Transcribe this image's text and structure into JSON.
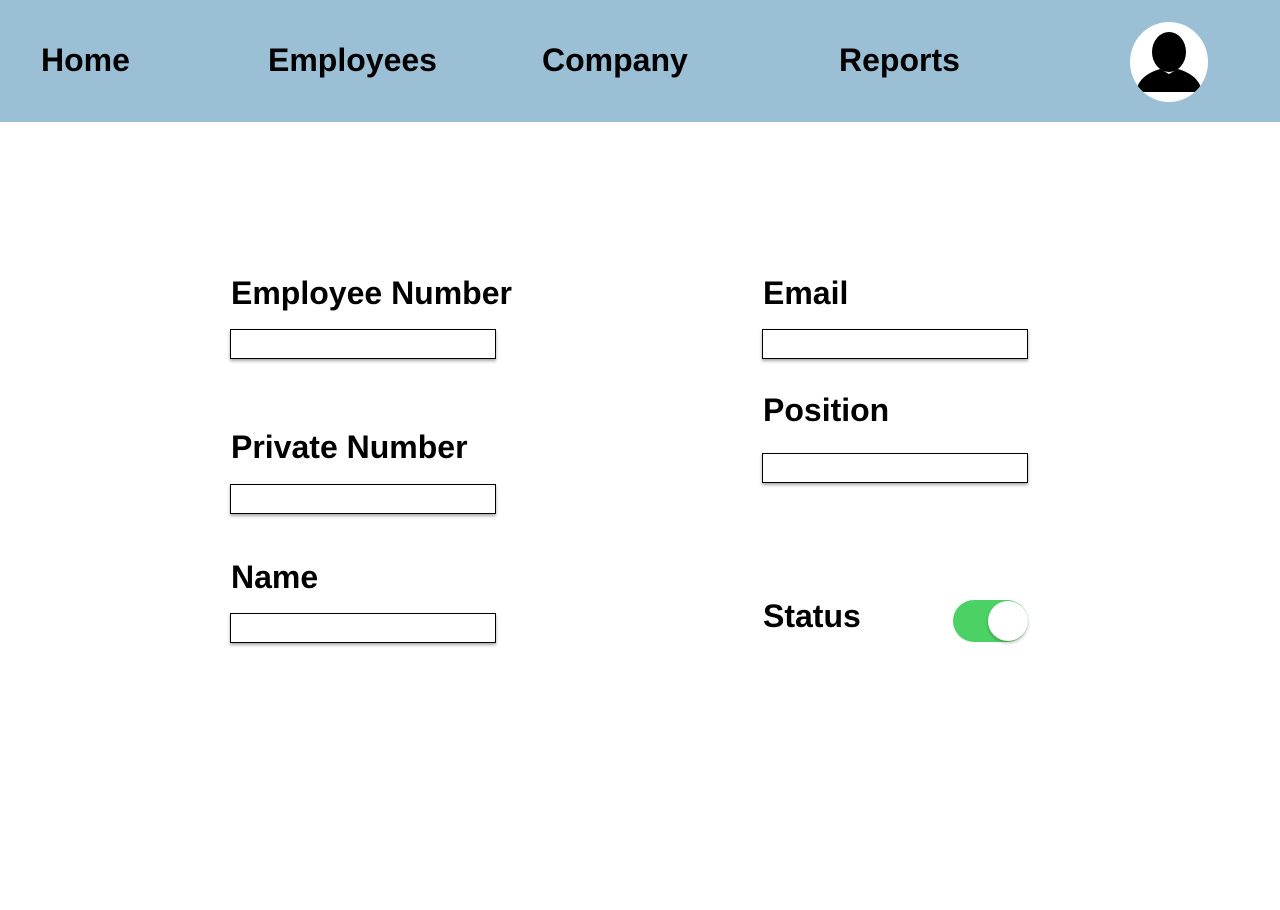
{
  "nav": {
    "items": [
      {
        "label": "Home"
      },
      {
        "label": "Employees"
      },
      {
        "label": "Company"
      },
      {
        "label": "Reports"
      }
    ],
    "background_color": "#9bbfd5",
    "avatar_icon": "user-silhouette-icon"
  },
  "form": {
    "employee_number": {
      "label": "Employee Number",
      "value": ""
    },
    "private_number": {
      "label": "Private Number",
      "value": ""
    },
    "name": {
      "label": "Name",
      "value": ""
    },
    "email": {
      "label": "Email",
      "value": ""
    },
    "position": {
      "label": "Position",
      "value": ""
    },
    "status": {
      "label": "Status",
      "enabled": true,
      "color": "#4cd264"
    }
  }
}
